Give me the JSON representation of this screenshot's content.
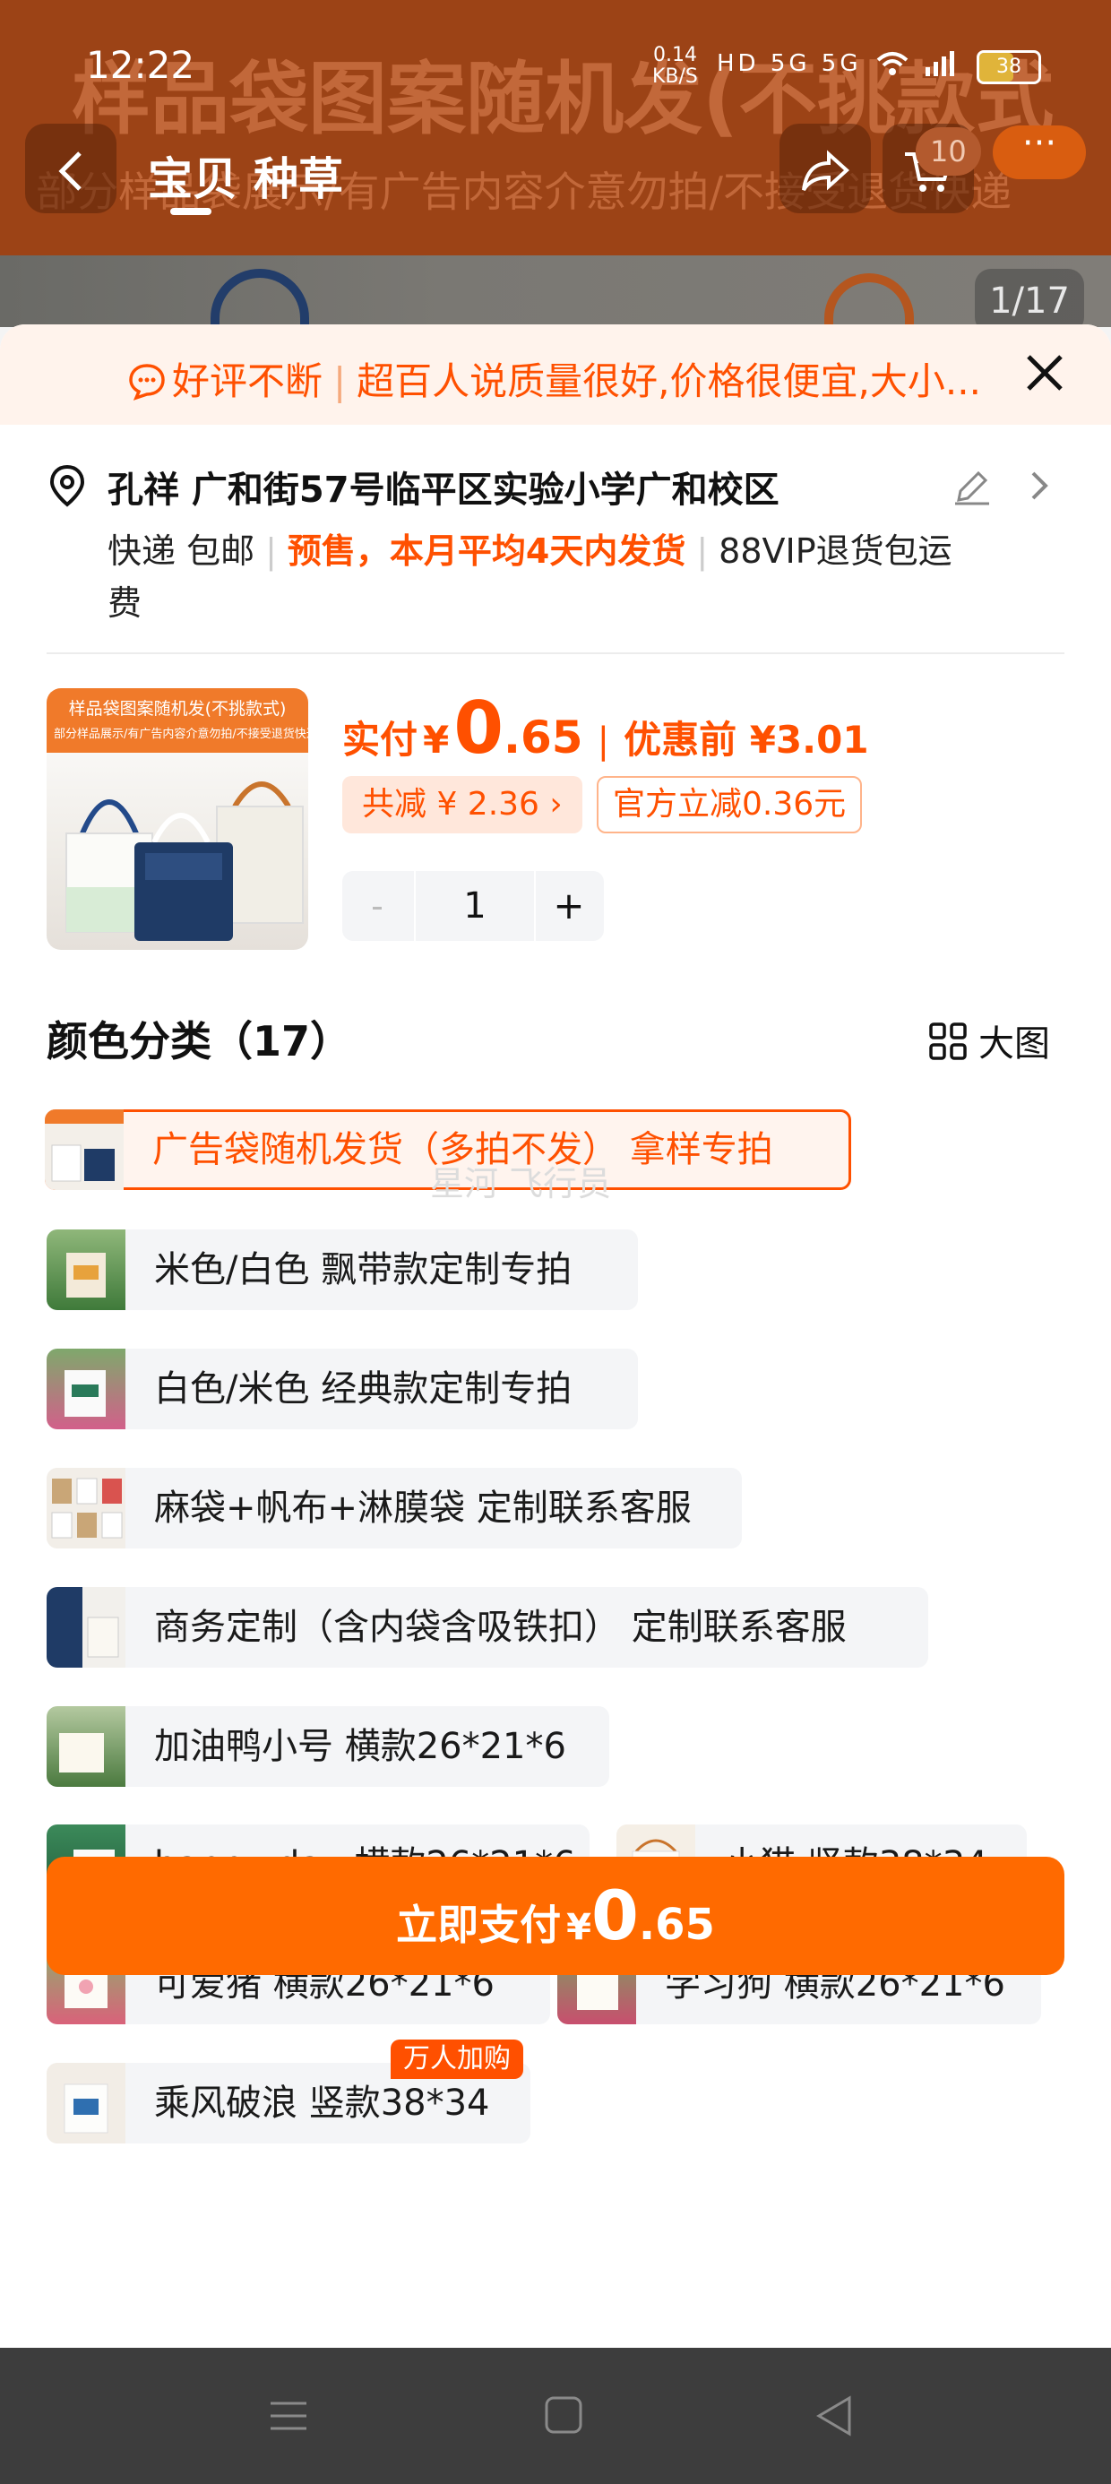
{
  "status_bar": {
    "time": "12:22",
    "speed_value": "0.14",
    "speed_unit": "KB/S",
    "network": "HD 5G 5G",
    "battery": "38"
  },
  "background": {
    "title": "样品袋图案随机发(不挑款式)",
    "subtitle": "部分样品袋展示/有广告内容介意勿拍/不接受退货快递",
    "tabs": [
      "宝贝",
      "种草"
    ],
    "cart_count": "10",
    "more": "···",
    "image_counter": "1/17"
  },
  "banner": {
    "tag": "好评不断",
    "text": "超百人说质量很好,价格很便宜,大小..."
  },
  "address": {
    "text": "孔祥 广和街57号临平区实验小学广和校区"
  },
  "delivery": {
    "method": "快递 包邮",
    "presale": "预售，本月平均4天内发货",
    "refund": "88VIP退货包运费"
  },
  "product": {
    "image_caption": "样品袋图案随机发(不挑款式)",
    "image_subcaption": "部分样品展示/有广告内容介意勿拍/不接受退货快递",
    "price_label": "实付",
    "currency": "¥",
    "price_int": "0",
    "price_dec": ".65",
    "price_before": "优惠前 ¥3.01",
    "discount_chip": "共减 ¥ 2.36 ›",
    "official_chip": "官方立减0.36元",
    "quantity": "1",
    "minus": "-",
    "plus": "+"
  },
  "colors": {
    "title": "颜色分类（17）",
    "big_view": "大图",
    "watermark": "星河 飞行员",
    "options": [
      {
        "label": "广告袋随机发货（多拍不发） 拿样专拍",
        "selected": true
      },
      {
        "label": "米色/白色 飘带款定制专拍"
      },
      {
        "label": "白色/米色 经典款定制专拍"
      },
      {
        "label": "麻袋+帆布+淋膜袋 定制联系客服"
      },
      {
        "label": "商务定制（含内袋含吸铁扣） 定制联系客服"
      },
      {
        "label": "加油鸭小号 横款26*21*6"
      },
      {
        "label": "happy day 横款26*21*6"
      },
      {
        "label": "小猫 竖款38*34"
      },
      {
        "label": "可爱猪 横款26*21*6"
      },
      {
        "label": "学习狗 横款26*21*6"
      },
      {
        "label": "乘风破浪 竖款38*34",
        "tag": "万人加购"
      }
    ]
  },
  "pay_button": {
    "label": "立即支付",
    "currency": "¥",
    "price_int": "0",
    "price_dec": ".65"
  },
  "theme": {
    "accent": "#ff5000",
    "button": "#ff6a00"
  }
}
